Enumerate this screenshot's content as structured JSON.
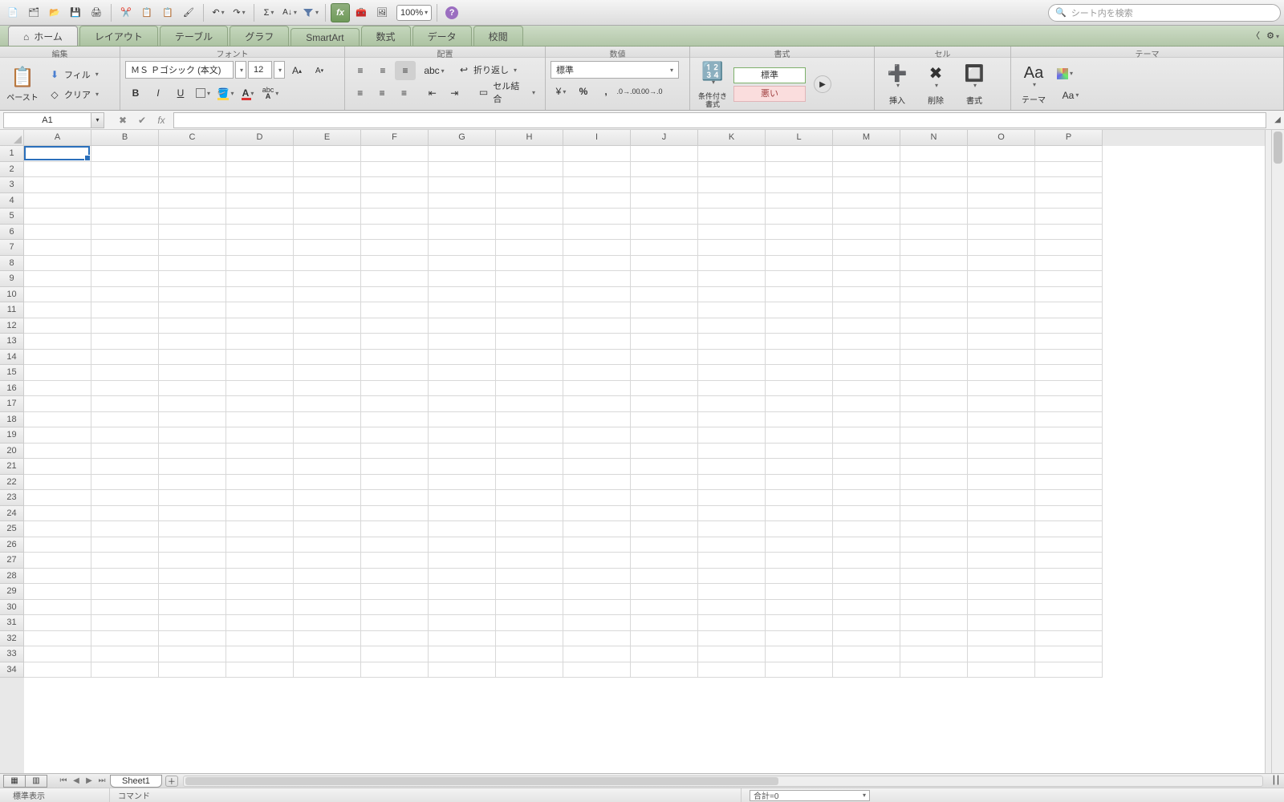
{
  "toolbar": {
    "zoom": "100%",
    "search_placeholder": "シート内を検索"
  },
  "tabs": {
    "home": "ホーム",
    "layout": "レイアウト",
    "tables": "テーブル",
    "charts": "グラフ",
    "smartart": "SmartArt",
    "formulas": "数式",
    "data": "データ",
    "review": "校閲"
  },
  "groups": {
    "edit": "編集",
    "font": "フォント",
    "align": "配置",
    "number": "数値",
    "format": "書式",
    "cells": "セル",
    "themes": "テーマ"
  },
  "ribbon": {
    "paste": "ペースト",
    "fill": "フィル",
    "clear": "クリア",
    "font_name": "ＭＳ Ｐゴシック (本文)",
    "font_size": "12",
    "wrap": "折り返し",
    "merge": "セル結合",
    "number_format": "標準",
    "cond_format": "条件付き書式",
    "style_normal": "標準",
    "style_bad": "悪い",
    "insert": "挿入",
    "delete": "削除",
    "format_btn": "書式",
    "themes_btn": "テーマ"
  },
  "namebox": {
    "ref": "A1",
    "fx": "fx"
  },
  "grid": {
    "columns": [
      "A",
      "B",
      "C",
      "D",
      "E",
      "F",
      "G",
      "H",
      "I",
      "J",
      "K",
      "L",
      "M",
      "N",
      "O",
      "P"
    ],
    "rows": [
      "1",
      "2",
      "3",
      "4",
      "5",
      "6",
      "7",
      "8",
      "9",
      "10",
      "11",
      "12",
      "13",
      "14",
      "15",
      "16",
      "17",
      "18",
      "19",
      "20",
      "21",
      "22",
      "23",
      "24",
      "25",
      "26",
      "27",
      "28",
      "29",
      "30",
      "31",
      "32",
      "33",
      "34"
    ]
  },
  "sheetbar": {
    "sheet1": "Sheet1"
  },
  "status": {
    "view_mode": "標準表示",
    "command": "コマンド",
    "sum": "合計=0"
  }
}
